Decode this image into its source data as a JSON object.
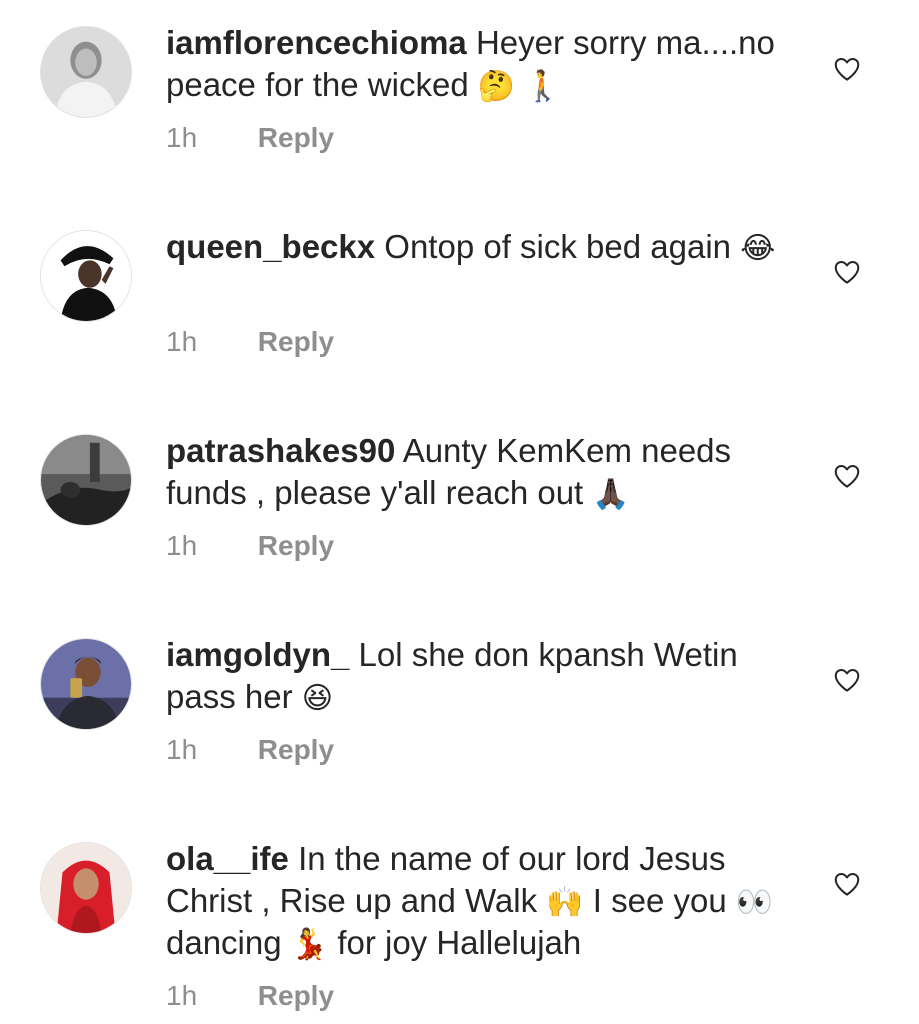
{
  "comments": [
    {
      "username": "iamflorencechioma",
      "text_before": "Heyer sorry ma....no peace for the wicked",
      "emojis": [
        "🤔",
        "🚶"
      ],
      "text_after": "",
      "time": "1h",
      "reply": "Reply",
      "avatar_colors": {
        "bg": "#d9d9d9",
        "skin": "#b7b7b7",
        "hair": "#8a8a8a",
        "cloth": "#f2f2f2"
      }
    },
    {
      "username": "queen_beckx",
      "text_before": "Ontop of sick bed again",
      "emojis": [
        "😂"
      ],
      "text_after": "",
      "time": "1h",
      "reply": "Reply",
      "avatar_colors": {
        "bg": "#ffffff",
        "skin": "#3a2a22",
        "hair": "#111111",
        "cloth": "#1a1a1a"
      }
    },
    {
      "username": "patrashakes90",
      "text_before": "Aunty KemKem needs funds , please y'all reach out",
      "emojis": [
        "🙏🏿"
      ],
      "text_after": "",
      "time": "1h",
      "reply": "Reply",
      "avatar_colors": {
        "bg": "#6d6d6d",
        "skin": "#2b2b2b",
        "hair": "#1b1b1b",
        "cloth": "#3a3a3a"
      }
    },
    {
      "username": "iamgoldyn_",
      "text_before": "Lol she don kpansh Wetin pass her",
      "emojis": [
        "😆"
      ],
      "text_after": "",
      "time": "1h",
      "reply": "Reply",
      "avatar_colors": {
        "bg": "#6a6fa8",
        "skin": "#7a4f36",
        "hair": "#2a2a2a",
        "cloth": "#2e2e3a"
      }
    },
    {
      "username": "ola__ife",
      "text_before": "In the name of our lord Jesus Christ , Rise up and Walk",
      "emojis": [
        "🙌"
      ],
      "text_mid": "I see you",
      "emojis2": [
        "👀"
      ],
      "text_mid2": "dancing",
      "emojis3": [
        "💃"
      ],
      "text_after": "for joy Hallelujah",
      "time": "1h",
      "reply": "Reply",
      "avatar_colors": {
        "bg": "#f3e9e4",
        "skin": "#c58e6c",
        "hair": "#e0202a",
        "cloth": "#c81a22"
      }
    }
  ],
  "like_icon": "heart-outline-icon",
  "colors": {
    "text": "#262626",
    "muted": "#8e8e8e",
    "background": "#ffffff"
  }
}
